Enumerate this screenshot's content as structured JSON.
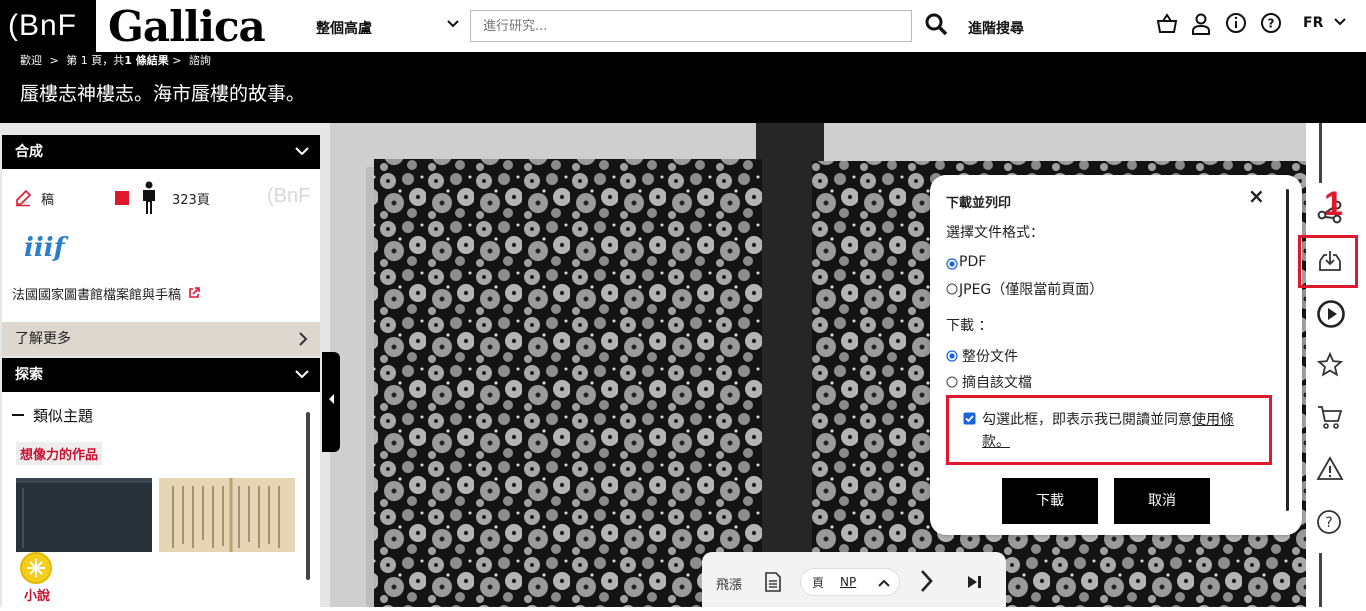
{
  "header": {
    "bnf_logo": "(BnF",
    "gallica_logo": "Gallica",
    "scope": "整個高盧",
    "search_placeholder": "進行研究...",
    "advanced_search": "進階搜尋",
    "language": "FR"
  },
  "breadcrumb": {
    "home": "歡迎",
    "sep1": ">",
    "results_prefix": "第 1 頁，共",
    "results_count": "1 條結果",
    "sep2": ">",
    "current": "諮詢"
  },
  "title": "蜃樓志神樓志。海市蜃樓的故事。",
  "left_panel": {
    "section_synthesis": "合成",
    "doc_type": "稿",
    "pages": "323頁",
    "bnf_watermark": "(BnF",
    "iiif_label": "iiif",
    "source": "法國國家圖書館檔案館與手稿",
    "learn_more": "了解更多",
    "section_explore": "探索",
    "similar_subjects": "類似主題",
    "tag_imaginary": "想像力的作品",
    "tag_novel": "小說"
  },
  "download_dialog": {
    "title": "下載並列印",
    "format_label": "選擇文件格式：",
    "format_pdf": "PDF",
    "format_jpeg": "JPEG（僅限當前頁面）",
    "download_label": "下載 ：",
    "download_whole": "整份文件",
    "download_excerpt": "摘自該文檔",
    "terms_text": "勾選此框，即表示我已閱讀並同意",
    "terms_link_1": "使用條",
    "terms_link_2": "款。",
    "download_button": "下載",
    "cancel_button": "取消",
    "close_symbol": "×"
  },
  "bottom_nav": {
    "jump_label": "飛漲",
    "page_prefix": "頁",
    "page_value": "NP"
  },
  "annotation_marker": "1",
  "colors": {
    "highlight_red": "#e0182d",
    "tag_red": "#c8102e"
  }
}
